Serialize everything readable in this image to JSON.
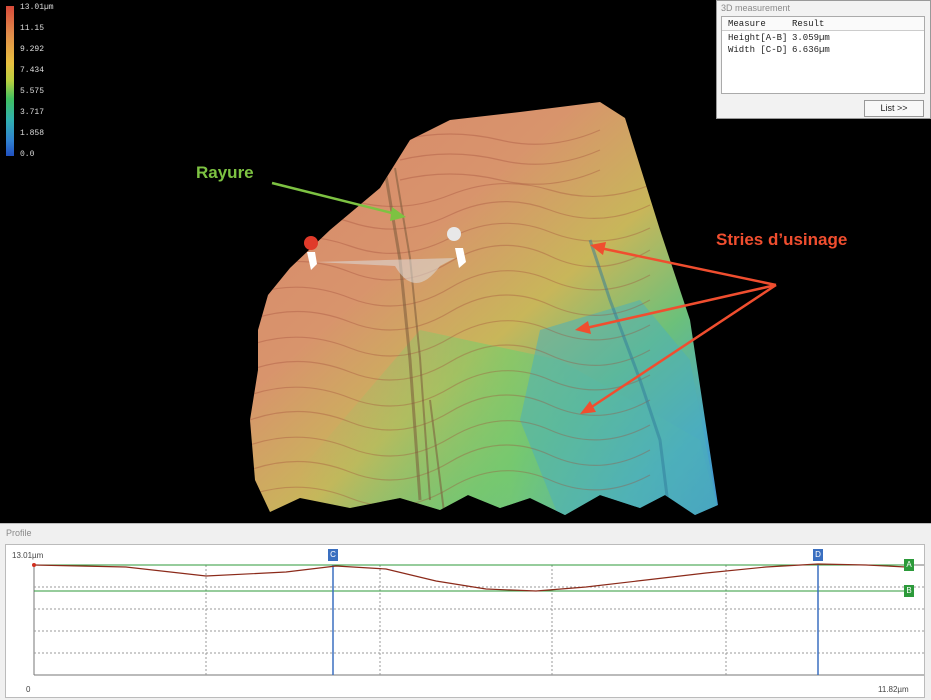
{
  "legend": {
    "labels": [
      "13.01µm",
      "11.15",
      "9.292",
      "7.434",
      "5.575",
      "3.717",
      "1.858",
      "0.0"
    ]
  },
  "annotations": {
    "rayure": "Rayure",
    "stries": "Stries d’usinage",
    "rayure_color": "#7dc242",
    "stries_color": "#f04e2f"
  },
  "measurement_panel": {
    "title": "3D measurement",
    "col_measure": "Measure",
    "col_result": "Result",
    "rows": [
      {
        "measure": "Height[A-B]",
        "result": "3.059µm"
      },
      {
        "measure": "Width [C-D]",
        "result": "6.636µm"
      }
    ],
    "list_button": "List >>"
  },
  "profile_panel": {
    "title": "Profile",
    "y_max_label": "13.01µm",
    "x_start_label": "0",
    "x_end_label": "11.82µm",
    "marker_c": "C",
    "marker_d": "D",
    "marker_a": "A",
    "marker_b": "B",
    "marker_blue": "#3a6fc0",
    "marker_green": "#2c9a3a"
  }
}
